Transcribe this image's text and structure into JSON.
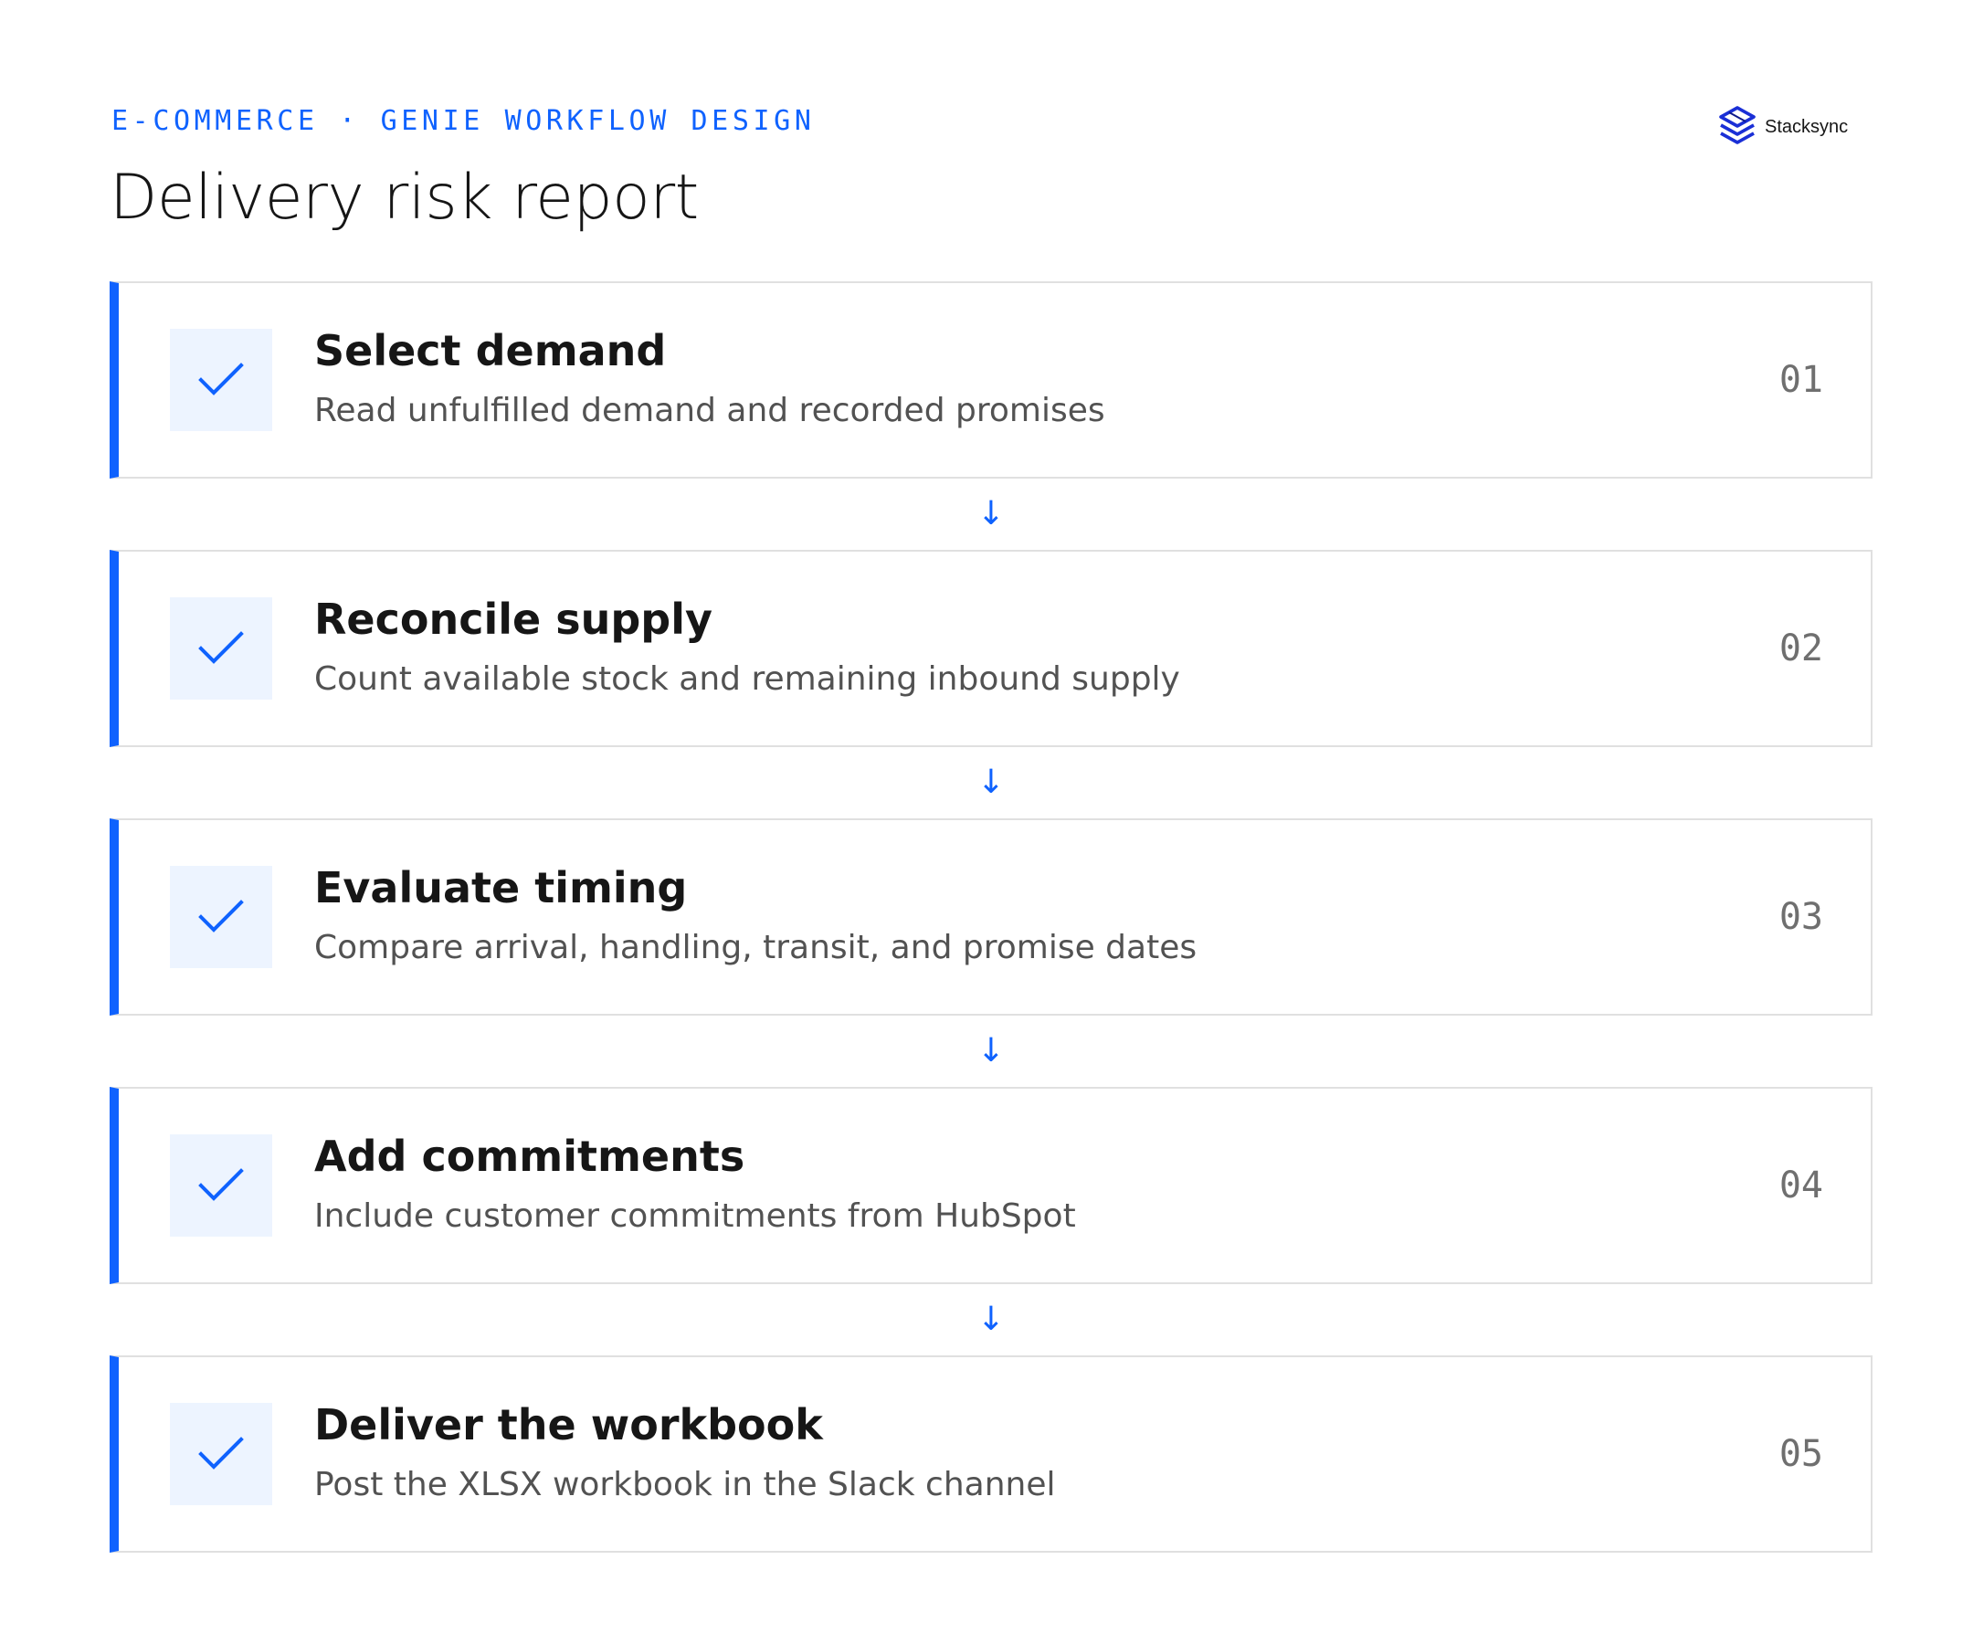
{
  "header": {
    "eyebrow": "E-COMMERCE · GENIE WORKFLOW DESIGN",
    "title": "Delivery risk report"
  },
  "brand": {
    "name": "Stacksync",
    "logo_icon": "stacksync-logo-icon"
  },
  "colors": {
    "accent": "#0f62fe",
    "check_background": "#edf4ff",
    "border": "#e0e0e0",
    "title_text": "#161616",
    "description_text": "#525252",
    "number_text": "#6f6f6f"
  },
  "connector_glyph": "↓",
  "steps": [
    {
      "icon": "checkmark-icon",
      "title": "Select demand",
      "description": "Read unfulfilled demand and recorded promises",
      "number": "01"
    },
    {
      "icon": "checkmark-icon",
      "title": "Reconcile supply",
      "description": "Count available stock and remaining inbound supply",
      "number": "02"
    },
    {
      "icon": "checkmark-icon",
      "title": "Evaluate timing",
      "description": "Compare arrival, handling, transit, and promise dates",
      "number": "03"
    },
    {
      "icon": "checkmark-icon",
      "title": "Add commitments",
      "description": "Include customer commitments from HubSpot",
      "number": "04"
    },
    {
      "icon": "checkmark-icon",
      "title": "Deliver the workbook",
      "description": "Post the XLSX workbook in the Slack channel",
      "number": "05"
    }
  ]
}
